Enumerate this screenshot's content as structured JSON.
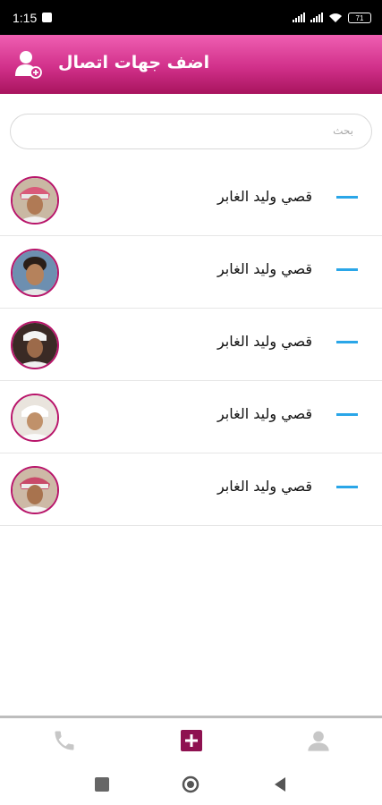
{
  "status_bar": {
    "time": "1:15",
    "battery": "71"
  },
  "header": {
    "title": "اضف جهات اتصال",
    "icon": "add-user-icon"
  },
  "search": {
    "placeholder": "بحث"
  },
  "contacts": [
    {
      "name": "قصي وليد الغابر",
      "avatar": "avatar-photo"
    },
    {
      "name": "قصي وليد الغابر",
      "avatar": "avatar-photo"
    },
    {
      "name": "قصي وليد الغابر",
      "avatar": "avatar-photo"
    },
    {
      "name": "قصي وليد الغابر",
      "avatar": "avatar-photo"
    },
    {
      "name": "قصي وليد الغابر",
      "avatar": "avatar-photo"
    }
  ],
  "bottom_nav": [
    {
      "icon": "phone-icon",
      "active": false
    },
    {
      "icon": "add-icon",
      "active": true
    },
    {
      "icon": "profile-icon",
      "active": false
    }
  ],
  "colors": {
    "header_start": "#ef5fb2",
    "header_end": "#a8145e",
    "accent": "#8e1150",
    "remove": "#2aa6e8"
  }
}
